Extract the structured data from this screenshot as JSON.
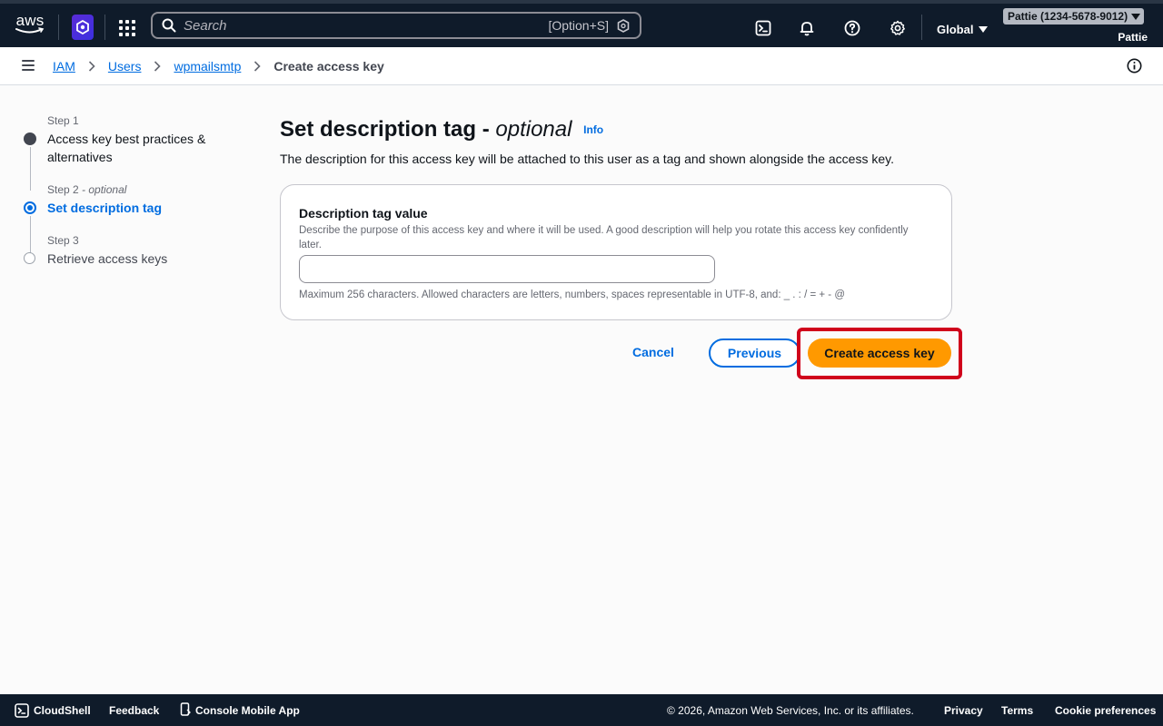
{
  "topnav": {
    "logo_text": "aws",
    "search_placeholder": "Search",
    "search_shortcut": "[Option+S]",
    "region": "Global",
    "account": "Pattie (1234-5678-9012)",
    "user": "Pattie",
    "icons": [
      "cloudshell-icon",
      "bell-icon",
      "help-icon",
      "settings-icon"
    ]
  },
  "breadcrumb": {
    "items": [
      "IAM",
      "Users",
      "wpmailsmtp"
    ],
    "current": "Create access key"
  },
  "steps": [
    {
      "label": "Step 1",
      "title": "Access key best practices & alternatives",
      "state": "done"
    },
    {
      "label": "Step 2",
      "label_suffix": "- optional",
      "title": "Set description tag",
      "state": "active"
    },
    {
      "label": "Step 3",
      "title": "Retrieve access keys",
      "state": "todo"
    }
  ],
  "main": {
    "title": "Set description tag -",
    "title_suffix": "optional",
    "info": "Info",
    "description": "The description for this access key will be attached to this user as a tag and shown alongside the access key.",
    "field": {
      "label": "Description tag value",
      "description": "Describe the purpose of this access key and where it will be used. A good description will help you rotate this access key confidently later.",
      "value": "",
      "hint": "Maximum 256 characters. Allowed characters are letters, numbers, spaces representable in UTF-8, and: _ . : / = + - @"
    },
    "buttons": {
      "cancel": "Cancel",
      "previous": "Previous",
      "create": "Create access key"
    }
  },
  "footer": {
    "cloudshell": "CloudShell",
    "feedback": "Feedback",
    "mobile_app": "Console Mobile App",
    "copyright": "© 2026, Amazon Web Services, Inc. or its affiliates.",
    "privacy": "Privacy",
    "terms": "Terms",
    "cookies": "Cookie preferences"
  },
  "colors": {
    "nav_bg": "#0f1b2a",
    "link": "#006ce0",
    "primary": "#ff9900",
    "highlight": "#d0021b"
  }
}
